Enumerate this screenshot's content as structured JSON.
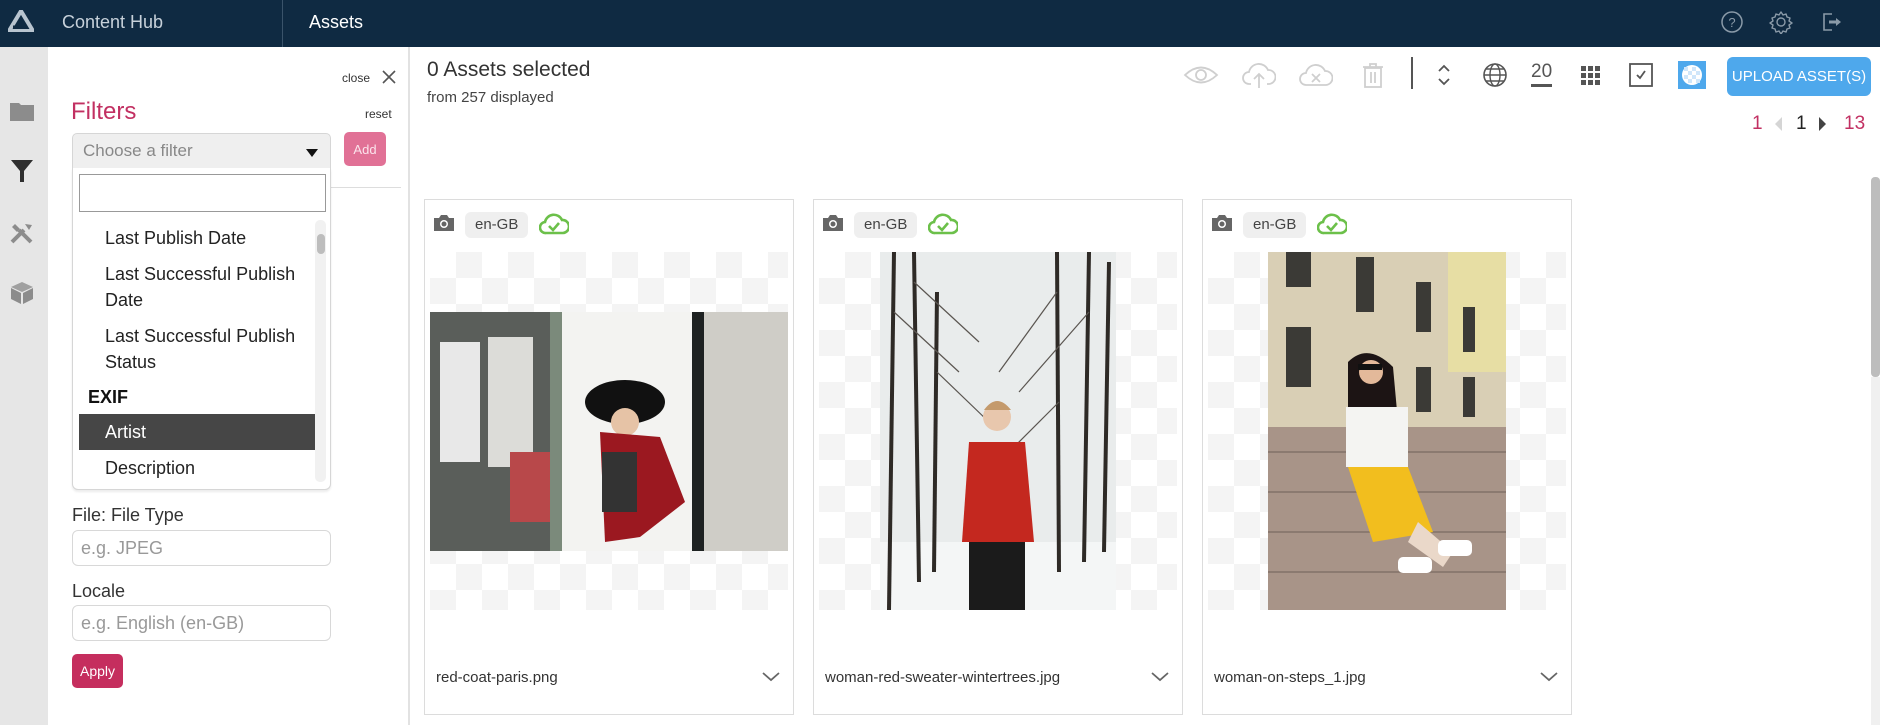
{
  "topbar": {
    "app_title": "Content Hub",
    "section_title": "Assets",
    "icons": [
      "logo-icon",
      "help-icon",
      "settings-icon",
      "logout-icon"
    ]
  },
  "rail": {
    "items": [
      {
        "icon": "folder-icon"
      },
      {
        "icon": "filter-icon"
      },
      {
        "icon": "tools-icon"
      },
      {
        "icon": "package-icon"
      }
    ]
  },
  "filters": {
    "close_label": "close",
    "title": "Filters",
    "reset_label": "reset",
    "choose_placeholder": "Choose a filter",
    "add_label": "Add",
    "search_value": "",
    "dropdown_options": [
      {
        "type": "item",
        "label": "Last Publish Date"
      },
      {
        "type": "item",
        "label": "Last Successful Publish Date"
      },
      {
        "type": "item",
        "label": "Last Successful Publish Status"
      },
      {
        "type": "group",
        "label": "EXIF"
      },
      {
        "type": "item",
        "label": "Artist",
        "highlighted": true
      },
      {
        "type": "item",
        "label": "Description"
      }
    ],
    "fields": [
      {
        "label": "File: File Type",
        "placeholder": "e.g. JPEG",
        "value": ""
      },
      {
        "label": "Locale",
        "placeholder": "e.g. English (en-GB)",
        "value": ""
      }
    ],
    "apply_label": "Apply"
  },
  "main": {
    "selected_title": "0 Assets selected",
    "selected_sub": "from 257 displayed",
    "toolbar": {
      "icons": [
        "preview-icon",
        "publish-cloud-icon",
        "unpublish-cloud-icon",
        "delete-icon",
        "sort-icon",
        "locale-globe-icon",
        "grid-view-icon",
        "select-all-checkbox-icon",
        "transparency-icon"
      ],
      "page_size": "20",
      "upload_label": "UPLOAD ASSET(S)"
    },
    "pagination": {
      "first": "1",
      "current": "1",
      "last": "13"
    },
    "assets": [
      {
        "name": "red-coat-paris.png",
        "locale": "en-GB",
        "status": "published"
      },
      {
        "name": "woman-red-sweater-wintertrees.jpg",
        "locale": "en-GB",
        "status": "published"
      },
      {
        "name": "woman-on-steps_1.jpg",
        "locale": "en-GB",
        "status": "published"
      }
    ]
  },
  "colors": {
    "topbar_bg": "#0f2a42",
    "accent_pink": "#c23062",
    "upload_blue": "#4ea8ec",
    "published_green": "#6cc04a"
  }
}
